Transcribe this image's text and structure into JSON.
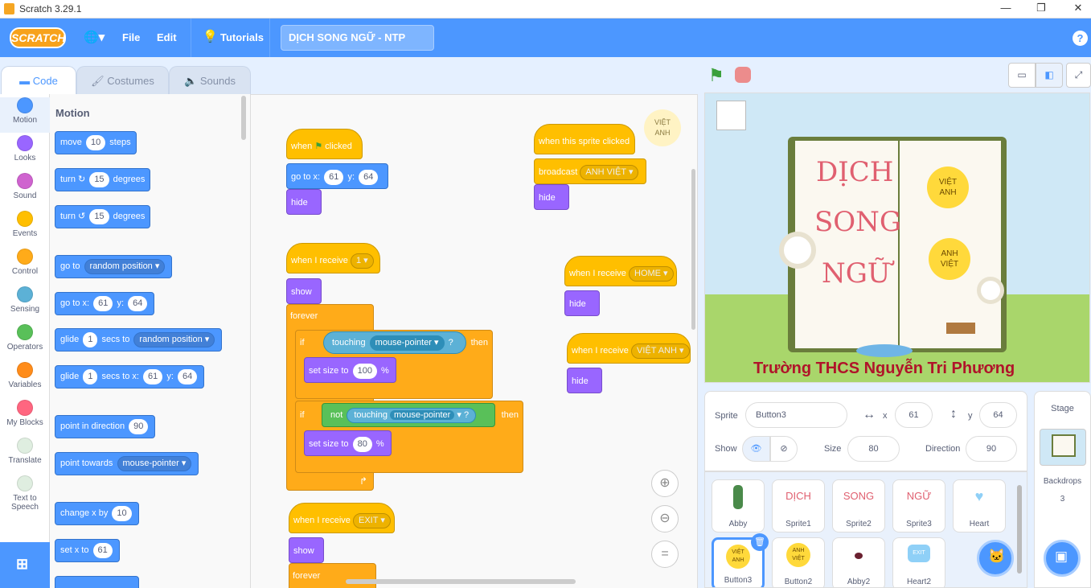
{
  "window": {
    "title": "Scratch 3.29.1",
    "min": "—",
    "max": "❐",
    "close": "✕"
  },
  "menubar": {
    "logo": "SCRATCH",
    "globe": "🌐▾",
    "file": "File",
    "edit": "Edit",
    "tutorials": "Tutorials",
    "project_title": "DỊCH SONG NGỮ - NTP",
    "help": "?"
  },
  "tabs": [
    {
      "label": "Code"
    },
    {
      "label": "Costumes"
    },
    {
      "label": "Sounds"
    }
  ],
  "categories": [
    {
      "label": "Motion",
      "color": "#4c97ff"
    },
    {
      "label": "Looks",
      "color": "#9966ff"
    },
    {
      "label": "Sound",
      "color": "#cf63cf"
    },
    {
      "label": "Events",
      "color": "#ffbf00"
    },
    {
      "label": "Control",
      "color": "#ffab19"
    },
    {
      "label": "Sensing",
      "color": "#5cb1d6"
    },
    {
      "label": "Operators",
      "color": "#59c059"
    },
    {
      "label": "Variables",
      "color": "#ff8c1a"
    },
    {
      "label": "My Blocks",
      "color": "#ff6680"
    },
    {
      "label": "Translate",
      "color": ""
    },
    {
      "label": "Text to Speech",
      "color": ""
    }
  ],
  "palette": {
    "heading": "Motion",
    "move": {
      "a": "move",
      "v": "10",
      "b": "steps"
    },
    "turn_r": {
      "a": "turn",
      "v": "15",
      "b": "degrees"
    },
    "turn_l": {
      "a": "turn",
      "v": "15",
      "b": "degrees"
    },
    "goto": {
      "a": "go to",
      "d": "random position"
    },
    "gotoxy": {
      "a": "go to x:",
      "x": "61",
      "b": "y:",
      "y": "64"
    },
    "glide1": {
      "a": "glide",
      "v": "1",
      "b": "secs to",
      "d": "random position"
    },
    "glide2": {
      "a": "glide",
      "v": "1",
      "b": "secs to x:",
      "x": "61",
      "c": "y:",
      "y": "64"
    },
    "pointdir": {
      "a": "point in direction",
      "v": "90"
    },
    "pointtow": {
      "a": "point towards",
      "d": "mouse-pointer"
    },
    "changex": {
      "a": "change x by",
      "v": "10"
    },
    "setx": {
      "a": "set x to",
      "v": "61"
    }
  },
  "scripts": {
    "s1": {
      "when": "when",
      "clicked": "clicked",
      "goto": "go to x:",
      "x": "61",
      "y_label": "y:",
      "y": "64",
      "hide": "hide"
    },
    "s2": {
      "recv": "when I receive",
      "msg": "1",
      "show": "show",
      "forever": "forever",
      "if1": "if",
      "touching": "touching",
      "mp": "mouse-pointer",
      "q": "?",
      "then": "then",
      "setsize": "set size to",
      "v1": "100",
      "pct": "%",
      "if2": "if",
      "not": "not",
      "v2": "80"
    },
    "s3": {
      "recv": "when I receive",
      "msg": "EXIT",
      "show": "show",
      "forever": "forever"
    },
    "s4": {
      "clicked": "when this sprite clicked",
      "broadcast": "broadcast",
      "msg": "ANH VIỆT",
      "hide": "hide"
    },
    "s5": {
      "recv": "when I receive",
      "msg": "HOME",
      "hide": "hide"
    },
    "s6": {
      "recv": "when I receive",
      "msg": "VIỆT ANH",
      "hide": "hide"
    },
    "badge": {
      "l1": "VIỆT",
      "l2": "ANH"
    }
  },
  "stage": {
    "title_l1": "DỊCH",
    "title_l2": "SONG",
    "title_l3": "NGỮ",
    "btn1_l1": "VIỆT",
    "btn1_l2": "ANH",
    "btn2_l1": "ANH",
    "btn2_l2": "VIỆT",
    "school": "Trường THCS Nguyễn Tri Phương"
  },
  "sprite_info": {
    "sprite_label": "Sprite",
    "sprite_name": "Button3",
    "x_label": "x",
    "x": "61",
    "y_label": "y",
    "y": "64",
    "show_label": "Show",
    "size_label": "Size",
    "size": "80",
    "direction_label": "Direction",
    "direction": "90"
  },
  "sprites": [
    {
      "name": "Abby"
    },
    {
      "name": "Sprite1",
      "text": "DỊCH"
    },
    {
      "name": "Sprite2",
      "text": "SONG"
    },
    {
      "name": "Sprite3",
      "text": "NGỮ"
    },
    {
      "name": "Heart"
    },
    {
      "name": "Button3",
      "t1": "VIỆT",
      "t2": "ANH"
    },
    {
      "name": "Button2",
      "t1": "ANH",
      "t2": "VIỆT"
    },
    {
      "name": "Abby2"
    },
    {
      "name": "Heart2",
      "text": "EXIT"
    }
  ],
  "stage_pane": {
    "title": "Stage",
    "backdrops_label": "Backdrops",
    "backdrops_count": "3"
  }
}
